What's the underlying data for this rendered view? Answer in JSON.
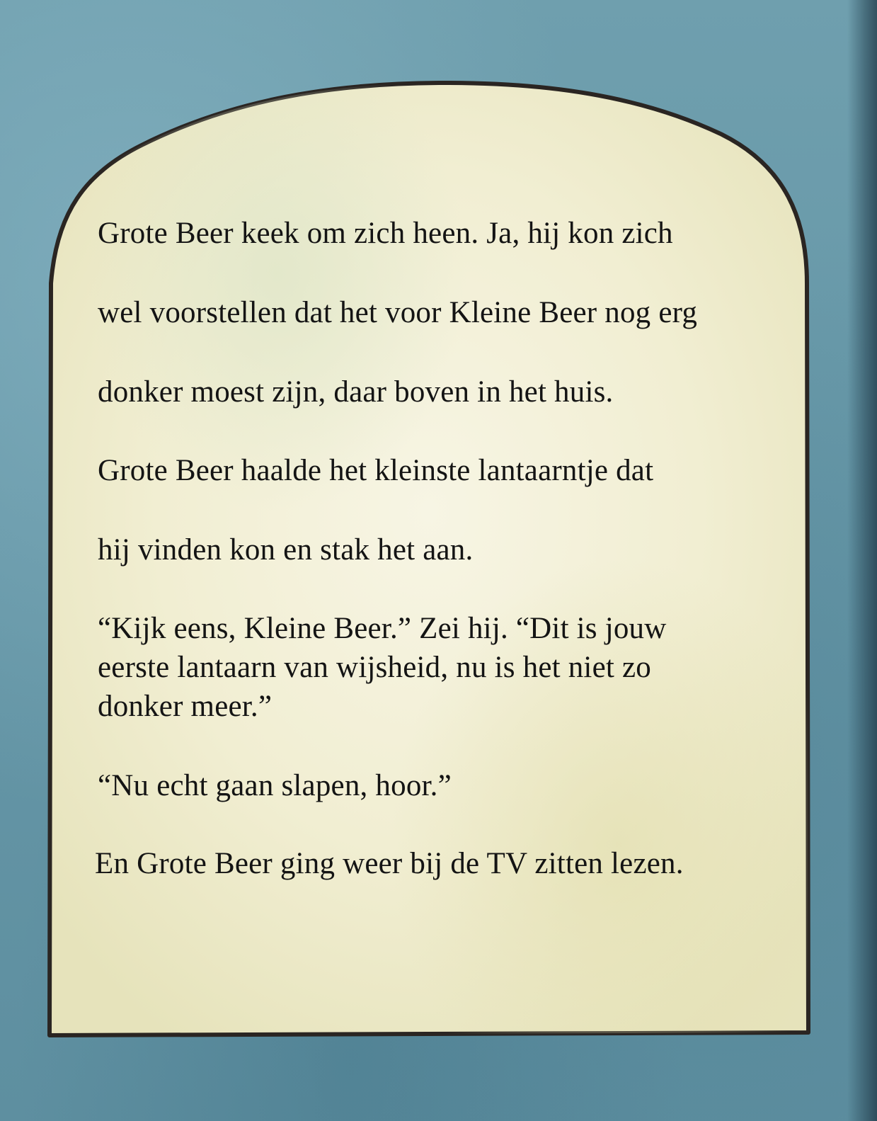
{
  "page": {
    "colors": {
      "background": "#6798a8",
      "parchment": "#f3f0d8",
      "border": "#2a2522",
      "text": "#141414"
    }
  },
  "story": {
    "lines": [
      "Grote Beer keek om zich heen. Ja, hij kon zich",
      "wel voorstellen dat het voor Kleine Beer nog erg",
      "donker moest zijn, daar boven in het huis.",
      "Grote Beer haalde het kleinste lantaarntje dat",
      "hij vinden kon en stak het aan.",
      "“Kijk eens, Kleine Beer.” Zei hij. “Dit is jouw",
      "eerste lantaarn van wijsheid, nu is het niet zo",
      "donker meer.”",
      "“Nu echt gaan slapen, hoor.”",
      "En Grote Beer ging weer bij de TV zitten lezen."
    ]
  }
}
